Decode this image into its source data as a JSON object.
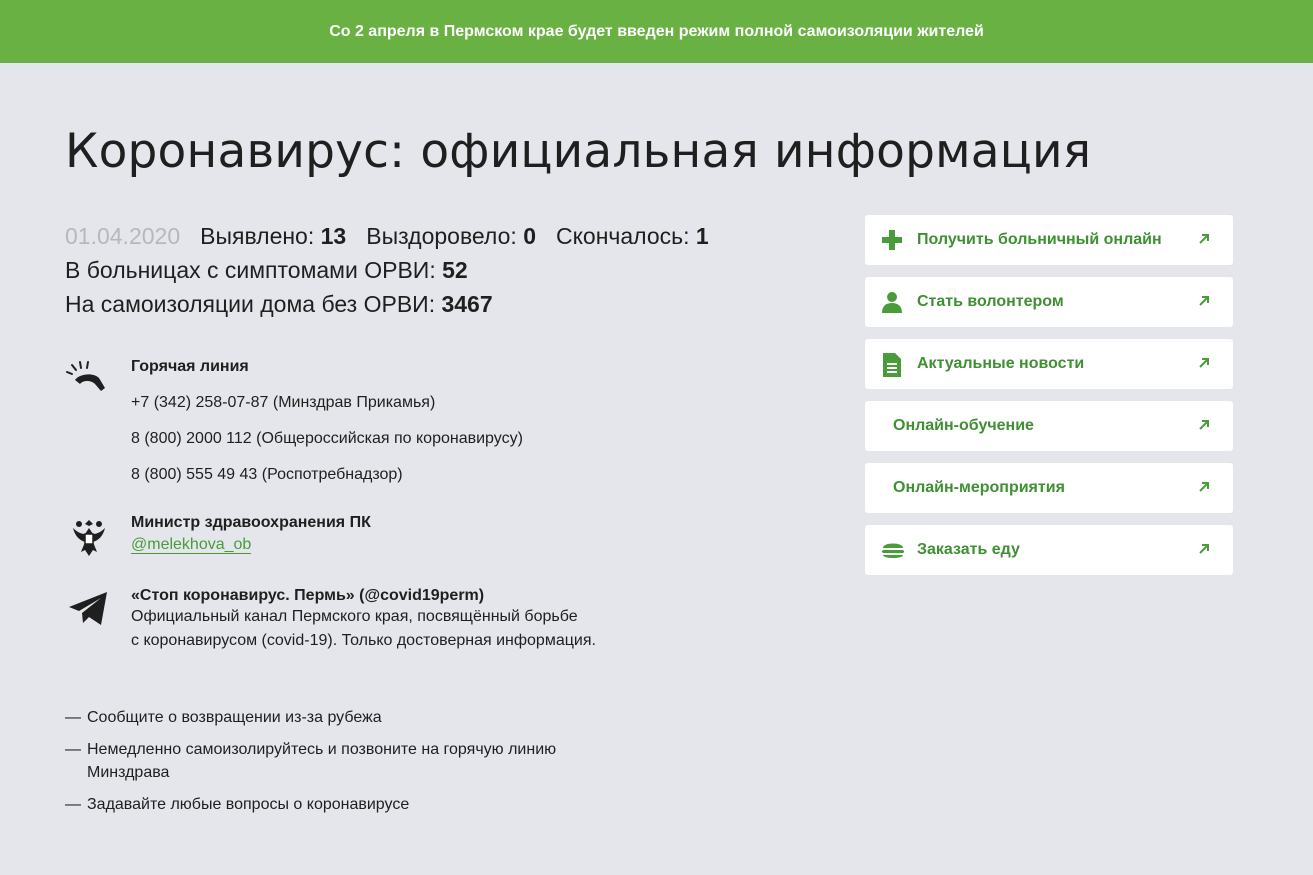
{
  "banner": {
    "text": "Со 2 апреля в Пермском крае будет введен режим полной самоизоляции жителей"
  },
  "page": {
    "title": "Коронавирус: официальная информация"
  },
  "stats": {
    "date": "01.04.2020",
    "detected_label": "Выявлено: ",
    "detected_value": "13",
    "recovered_label": "Выздоровело: ",
    "recovered_value": "0",
    "died_label": "Скончалось: ",
    "died_value": "1",
    "hospital_label": "В больницах с симптомами ОРВИ: ",
    "hospital_value": "52",
    "home_label": "На самоизоляции дома без ОРВИ: ",
    "home_value": "3467"
  },
  "hotline": {
    "title": "Горячая линия",
    "lines": [
      "+7 (342) 258-07-87 (Минздрав Прикамья)",
      "8 (800) 2000 112 (Общероссийская по коронавирусу)",
      "8 (800) 555 49 43 (Роспотребнадзор)"
    ]
  },
  "minister": {
    "title": "Министр здравоохранения ПК",
    "handle": "@melekhova_ob"
  },
  "channel": {
    "title": "«Стоп коронавирус. Пермь» (@covid19perm)",
    "desc_line1": "Официальный канал Пермского края, посвящённый борьбе",
    "desc_line2": "с коронавирусом (covid-19). Только достоверная информация."
  },
  "bullets": {
    "dash": "—",
    "items": [
      "Сообщите о возвращении из-за рубежа",
      "Немедленно самоизолируйтесь и позвоните на горячую линию",
      "Минздрава",
      "Задавайте любые вопросы о коронавирусе"
    ]
  },
  "links": [
    {
      "label": "Получить больничный онлайн",
      "icon": "plus-icon"
    },
    {
      "label": "Стать волонтером",
      "icon": "person-icon"
    },
    {
      "label": "Актуальные новости",
      "icon": "document-icon"
    },
    {
      "label": "Онлайн-обучение",
      "icon": ""
    },
    {
      "label": "Онлайн-мероприятия",
      "icon": ""
    },
    {
      "label": "Заказать еду",
      "icon": "burger-icon"
    }
  ],
  "colors": {
    "banner_bg": "#6ab143",
    "page_bg": "#e4e6ec",
    "accent_green": "#3f8f33",
    "muted_date": "#b4b8c0"
  }
}
